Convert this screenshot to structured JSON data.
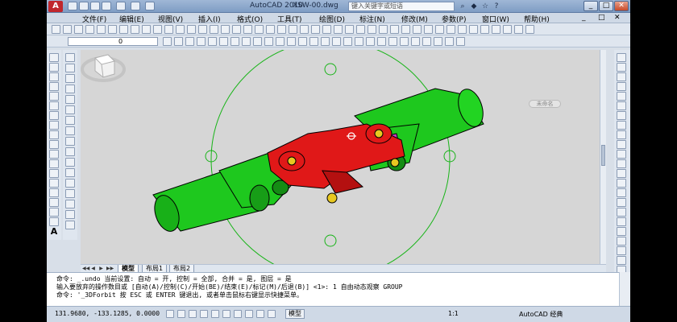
{
  "titlebar": {
    "app_logo": "A",
    "app_name": "AutoCAD 2010",
    "file_name": "XSW-00.dwg",
    "search_placeholder": "键入关键字或短语",
    "help_icon": "?",
    "buttons": [
      "_",
      "□",
      "✕"
    ]
  },
  "menu": {
    "items": [
      "文件(F)",
      "编辑(E)",
      "视图(V)",
      "插入(I)",
      "格式(O)",
      "工具(T)",
      "绘图(D)",
      "标注(N)",
      "修改(M)",
      "参数(P)",
      "窗口(W)",
      "帮助(H)"
    ]
  },
  "toolbar2": {
    "layer_value": "0"
  },
  "viewport": {
    "colors": {
      "shaft": "#1ec81e",
      "yoke": "#e01818",
      "cross": "#c83ac8",
      "bearing": "#e8c820",
      "orbit": "#18b418",
      "background": "#d6d6d6"
    },
    "viewcube_label": "未命名"
  },
  "tabs": {
    "items": [
      "模型",
      "布局1",
      "布局2"
    ],
    "nav_icons": [
      "◀◀",
      "◀",
      "▶",
      "▶▶"
    ]
  },
  "command": {
    "lines": [
      "命令: _.undo 当前设置: 自动 = 开, 控制 = 全部, 合并 = 是, 图层 = 是",
      "输入要放弃的操作数目或 [自动(A)/控制(C)/开始(BE)/结束(E)/标记(M)/后退(B)] <1>: 1 自由动态观察 GROUP",
      "命令: '_3DForbit 按 ESC 或 ENTER 键退出, 或者单击鼠标右键显示快捷菜单。"
    ]
  },
  "status": {
    "coordinates": "131.9680, -133.1285, 0.0000",
    "model_label": "模型",
    "scale": "1:1",
    "workspace": "AutoCAD 经典"
  }
}
